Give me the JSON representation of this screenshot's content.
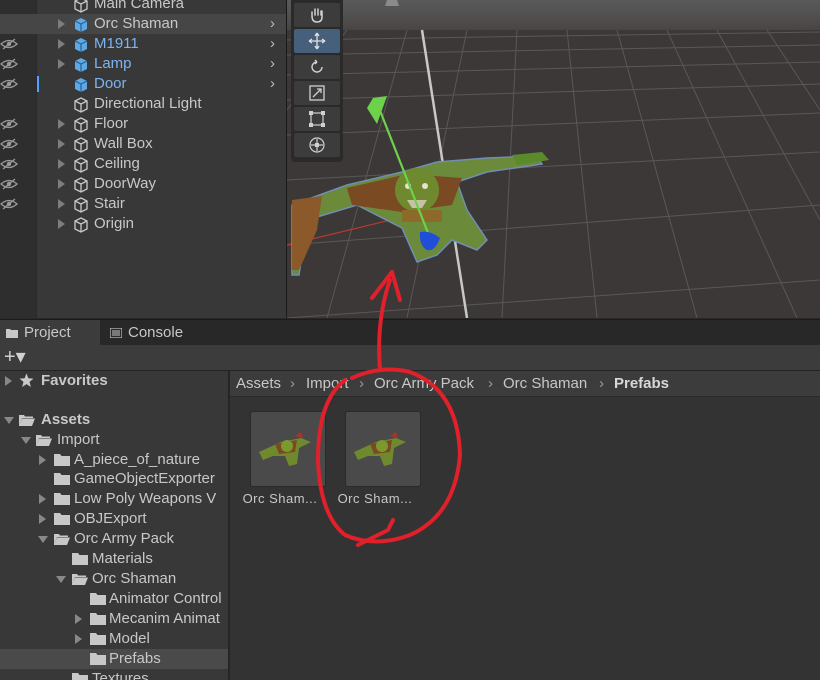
{
  "hierarchy": {
    "items": [
      {
        "label": "Main Camera",
        "prefab": false,
        "expandable": false,
        "has_chevron": false
      },
      {
        "label": "Orc Shaman",
        "prefab": false,
        "expandable": true,
        "has_chevron": true
      },
      {
        "label": "M1911",
        "prefab": true,
        "expandable": true,
        "has_chevron": true
      },
      {
        "label": "Lamp",
        "prefab": true,
        "expandable": true,
        "has_chevron": true
      },
      {
        "label": "Door",
        "prefab": true,
        "expandable": false,
        "has_chevron": true
      },
      {
        "label": "Directional Light",
        "prefab": false,
        "expandable": false,
        "has_chevron": false
      },
      {
        "label": "Floor",
        "prefab": false,
        "expandable": true,
        "has_chevron": false
      },
      {
        "label": "Wall Box",
        "prefab": false,
        "expandable": true,
        "has_chevron": false
      },
      {
        "label": "Ceiling",
        "prefab": false,
        "expandable": true,
        "has_chevron": false
      },
      {
        "label": "DoorWay",
        "prefab": false,
        "expandable": true,
        "has_chevron": false
      },
      {
        "label": "Stair",
        "prefab": false,
        "expandable": true,
        "has_chevron": false
      },
      {
        "label": "Origin",
        "prefab": false,
        "expandable": true,
        "has_chevron": false
      }
    ],
    "chevron": "›"
  },
  "scene": {
    "tools": [
      "hand-tool-icon",
      "move-tool-icon",
      "rotate-tool-icon",
      "scale-tool-icon",
      "rect-tool-icon",
      "transform-tool-icon"
    ],
    "active_tool": "move-tool-icon"
  },
  "bottom": {
    "tabs": [
      {
        "label": "Project",
        "icon": "folder-icon",
        "active": true
      },
      {
        "label": "Console",
        "icon": "console-icon",
        "active": false
      }
    ],
    "create_label": "+▾"
  },
  "project_tree": {
    "favorites": "Favorites",
    "assets": "Assets",
    "items": [
      {
        "label": "Import"
      },
      {
        "label": "A_piece_of_nature"
      },
      {
        "label": "GameObjectExporter"
      },
      {
        "label": "Low Poly Weapons V"
      },
      {
        "label": "OBJExport"
      },
      {
        "label": "Orc Army Pack"
      },
      {
        "label": "Materials"
      },
      {
        "label": "Orc Shaman"
      },
      {
        "label": "Animator Control"
      },
      {
        "label": "Mecanim Animat"
      },
      {
        "label": "Model"
      },
      {
        "label": "Prefabs"
      },
      {
        "label": "Textures"
      }
    ]
  },
  "breadcrumb": {
    "parts": [
      "Assets",
      "Import",
      "Orc Army Pack",
      "Orc Shaman",
      "Prefabs"
    ],
    "separator": "›"
  },
  "assets": [
    {
      "label": "Orc Sham..."
    },
    {
      "label": "Orc Sham..."
    }
  ],
  "colors": {
    "prefab_text": "#7db4f0",
    "selection_marker": "#4da3ff",
    "annotation": "#e0202a"
  }
}
